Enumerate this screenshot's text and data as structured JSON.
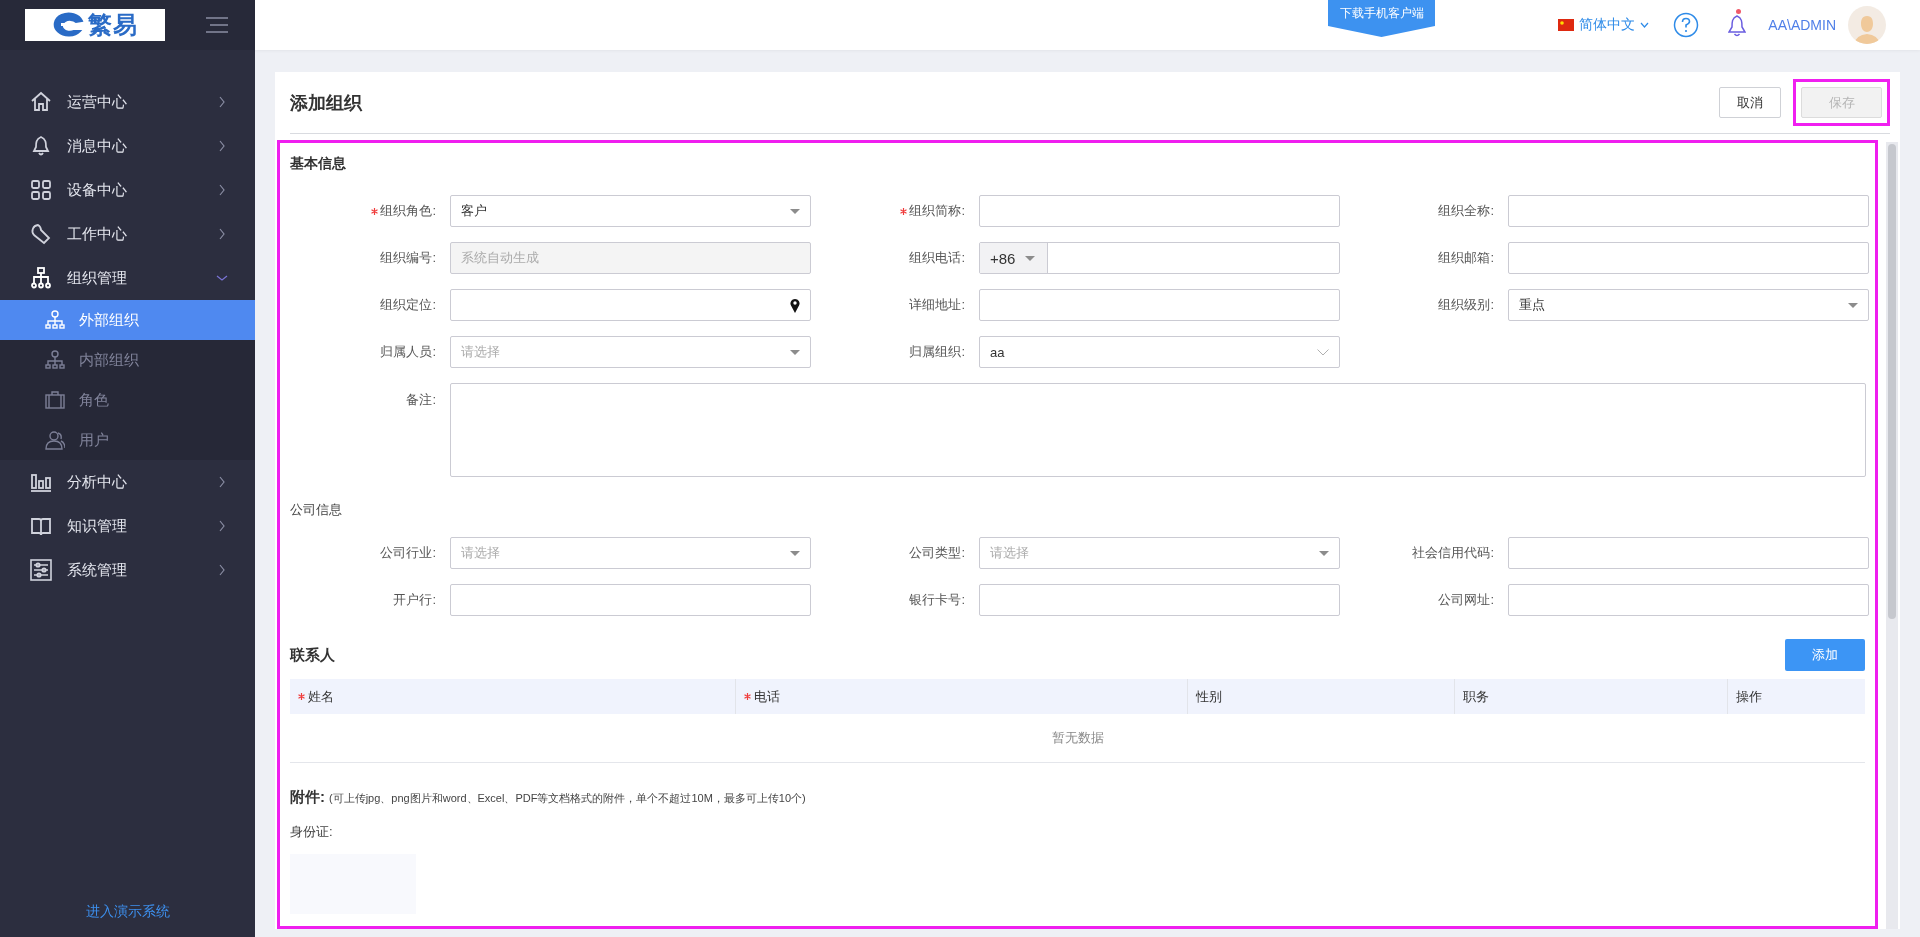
{
  "logo": {
    "text": "繁易"
  },
  "sidebar": {
    "items": [
      {
        "label": "运营中心",
        "expanded": false,
        "selected": false
      },
      {
        "label": "消息中心",
        "expanded": false,
        "selected": false
      },
      {
        "label": "设备中心",
        "expanded": false,
        "selected": false
      },
      {
        "label": "工作中心",
        "expanded": false,
        "selected": false
      },
      {
        "label": "组织管理",
        "expanded": true,
        "selected": false,
        "children": [
          {
            "label": "外部组织",
            "selected": true
          },
          {
            "label": "内部组织",
            "selected": false
          },
          {
            "label": "角色",
            "selected": false
          },
          {
            "label": "用户",
            "selected": false
          }
        ]
      },
      {
        "label": "分析中心",
        "expanded": false,
        "selected": false
      },
      {
        "label": "知识管理",
        "expanded": false,
        "selected": false
      },
      {
        "label": "系统管理",
        "expanded": false,
        "selected": false
      }
    ],
    "footer_link": "进入演示系统"
  },
  "header": {
    "download_badge": "下载手机客户端",
    "language": "简体中文",
    "unread_notifications": true,
    "user": "AA\\ADMIN"
  },
  "page": {
    "title": "添加组织",
    "buttons": [
      {
        "label": "取消",
        "disabled": false,
        "highlighted": false
      },
      {
        "label": "保存",
        "disabled": true,
        "highlighted": true
      }
    ]
  },
  "form": {
    "highlighted": true,
    "section_title": "基本信息",
    "fields": [
      {
        "label": "组织角色:",
        "required": true,
        "kind": "select",
        "value": "客户"
      },
      {
        "label": "组织简称:",
        "required": true,
        "kind": "text"
      },
      {
        "label": "组织全称:",
        "required": false,
        "kind": "text"
      },
      {
        "label": "组织编号:",
        "required": false,
        "kind": "readonly",
        "placeholder": "系统自动生成"
      },
      {
        "label": "组织电话:",
        "required": false,
        "kind": "phone",
        "prefix": "+86"
      },
      {
        "label": "组织邮箱:",
        "required": false,
        "kind": "text"
      },
      {
        "label": "组织定位:",
        "required": false,
        "kind": "location"
      },
      {
        "label": "详细地址:",
        "required": false,
        "kind": "text"
      },
      {
        "label": "组织级别:",
        "required": false,
        "kind": "select",
        "value": "重点"
      },
      {
        "label": "归属人员:",
        "required": false,
        "kind": "select",
        "placeholder": "请选择"
      },
      {
        "label": "归属组织:",
        "required": false,
        "kind": "tree-select",
        "value": "aa"
      },
      {
        "label": "备注:",
        "required": false,
        "kind": "textarea"
      }
    ],
    "company_title": "公司信息",
    "company_fields": [
      {
        "label": "公司行业:",
        "required": false,
        "kind": "select",
        "placeholder": "请选择"
      },
      {
        "label": "公司类型:",
        "required": false,
        "kind": "select",
        "placeholder": "请选择"
      },
      {
        "label": "社会信用代码:",
        "required": false,
        "kind": "text"
      },
      {
        "label": "开户行:",
        "required": false,
        "kind": "text"
      },
      {
        "label": "银行卡号:",
        "required": false,
        "kind": "text"
      },
      {
        "label": "公司网址:",
        "required": false,
        "kind": "text"
      }
    ]
  },
  "contacts": {
    "title": "联系人",
    "add_button": "添加",
    "columns": [
      {
        "label": "姓名",
        "required": true
      },
      {
        "label": "电话",
        "required": true
      },
      {
        "label": "性别",
        "required": false
      },
      {
        "label": "职务",
        "required": false
      },
      {
        "label": "操作",
        "required": false
      }
    ],
    "empty_text": "暂无数据"
  },
  "attachments": {
    "title": "附件:",
    "hint": "(可上传jpg、png图片和word、Excel、PDF等文档格式的附件，单个不超过10M，最多可上传10个)",
    "id_card_label": "身份证:"
  }
}
